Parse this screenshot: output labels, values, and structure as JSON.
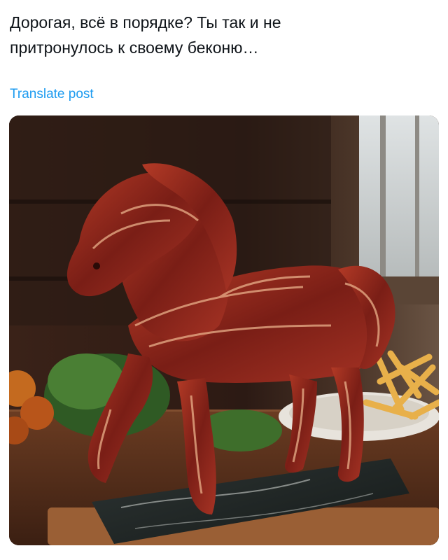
{
  "post": {
    "text_line_1": "Дорогая, всё в порядке? Ты так и не",
    "text_line_2": "притронулось к своему беконю…"
  },
  "translate": {
    "label": "Translate post"
  },
  "media": {
    "image_alt": "Bacon horse",
    "icon": "photo"
  },
  "colors": {
    "text": "#0f1419",
    "link": "#1d9bf0",
    "background": "#ffffff"
  }
}
